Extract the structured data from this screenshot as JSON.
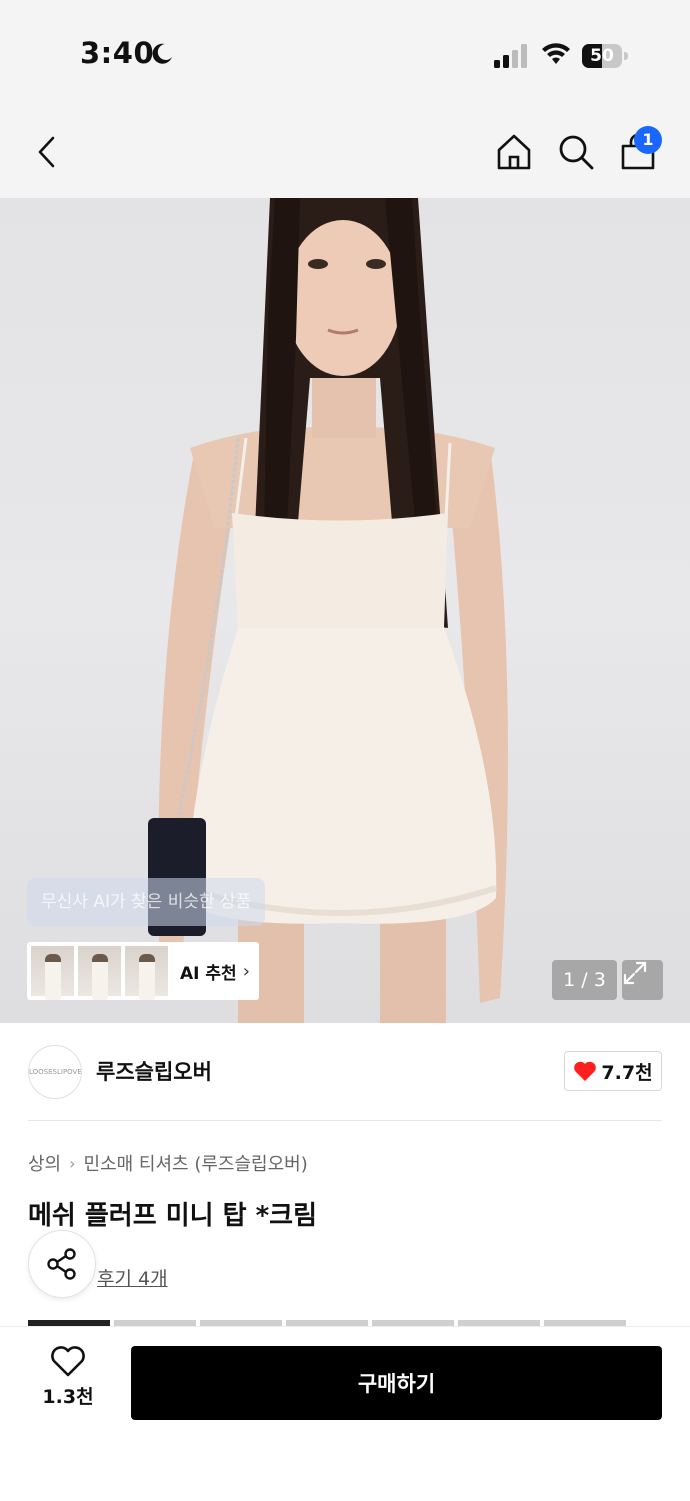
{
  "status_bar": {
    "time": "3:40",
    "battery_percent": 50,
    "battery_label": "50",
    "icons": [
      "moon-icon",
      "signal-icon",
      "wifi-icon",
      "battery-icon"
    ]
  },
  "nav": {
    "cart_badge": "1",
    "icons": [
      "back-icon",
      "home-icon",
      "search-icon",
      "cart-icon"
    ],
    "badge_color": "#1a66ff"
  },
  "hero": {
    "ai_tooltip": "무신사 AI가 찾은 비슷한 상품",
    "ai_recommend_label": "AI 추천",
    "page_counter": "1 / 3"
  },
  "brand": {
    "logo_text": "LOOSESLIPOVER",
    "name": "루즈슬립오버",
    "like_count": "7.7천",
    "heart_color": "#ff1f1f"
  },
  "product": {
    "breadcrumb": [
      "상의",
      "민소매 티셔츠 (루즈슬립오버)"
    ],
    "title": "메쉬 플러프 미니 탑 *크림",
    "review_link": "후기 4개"
  },
  "bottom_bar": {
    "like_count": "1.3천",
    "buy_label": "구매하기"
  }
}
